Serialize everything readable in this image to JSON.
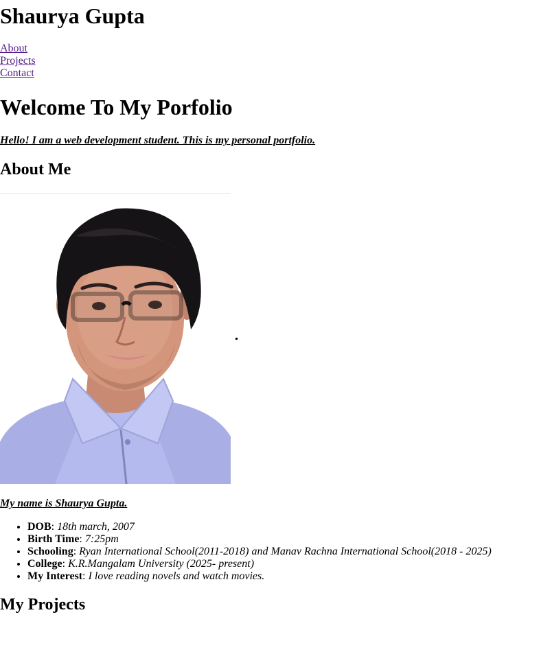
{
  "header": {
    "title": "Shaurya Gupta",
    "nav": [
      "About",
      "Projects",
      "Contact"
    ]
  },
  "hero": {
    "heading": "Welcome To My Porfolio",
    "intro": "Hello! I am a web development student. This is my personal portfolio."
  },
  "about": {
    "heading": "About Me",
    "name_line": "My name is Shaurya Gupta.",
    "details": [
      {
        "label": "DOB",
        "sep": ": ",
        "value": "18th march, 2007"
      },
      {
        "label": "Birth Time",
        "sep": ": ",
        "value": "7:25pm"
      },
      {
        "label": "Schooling",
        "sep": ": ",
        "value": "Ryan International School(2011-2018) and Manav Rachna International School(2018 - 2025)"
      },
      {
        "label": "College",
        "sep": ": ",
        "value": "K.R.Mangalam University (2025- present)"
      },
      {
        "label": "My Interest",
        "sep": ": ",
        "value": "I love reading novels and watch movies."
      }
    ]
  },
  "projects": {
    "heading": "My Projects"
  },
  "colors": {
    "link": "#551a8b",
    "photo_background": "#ffffff",
    "shirt": "#b3b8ef"
  }
}
